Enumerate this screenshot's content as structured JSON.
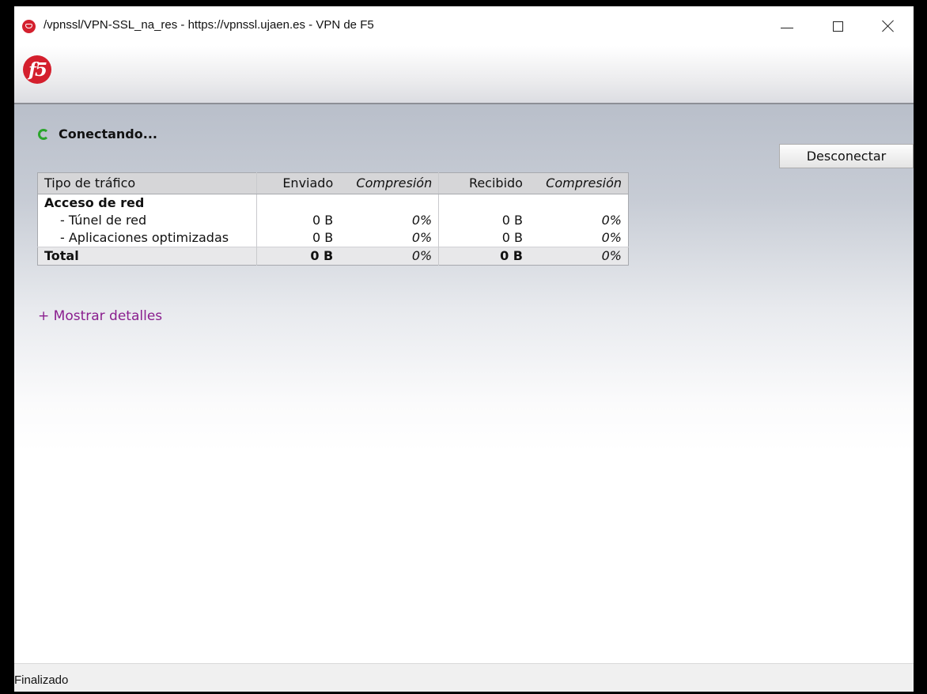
{
  "window": {
    "title": "/vpnssl/VPN-SSL_na_res - https://vpnssl.ujaen.es - VPN de F5",
    "icon": "f5-shield-icon"
  },
  "header": {
    "logo_text": "f5"
  },
  "connection": {
    "status": "Conectando...",
    "disconnect_label": "Desconectar"
  },
  "traffic_table": {
    "headers": [
      "Tipo de tráfico",
      "Enviado",
      "Compresión",
      "Recibido",
      "Compresión"
    ],
    "section_label": "Acceso de red",
    "rows": [
      {
        "label": "- Túnel de red",
        "sent": "0 B",
        "sent_comp": "0%",
        "received": "0 B",
        "received_comp": "0%"
      },
      {
        "label": "- Aplicaciones optimizadas",
        "sent": "0 B",
        "sent_comp": "0%",
        "received": "0 B",
        "received_comp": "0%"
      }
    ],
    "total": {
      "label": "Total",
      "sent": "0 B",
      "sent_comp": "0%",
      "received": "0 B",
      "received_comp": "0%"
    }
  },
  "details_link": "+ Mostrar detalles",
  "statusbar": {
    "text": "Finalizado"
  },
  "colors": {
    "brand_red": "#d41f2d",
    "spinner_green": "#2ba52b",
    "link_purple": "#8a1e8e"
  }
}
